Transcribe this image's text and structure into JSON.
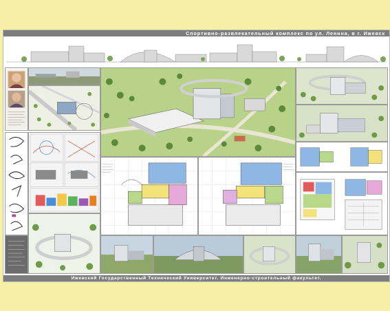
{
  "poster": {
    "title": "Спортивно-развлекательный комплекс по ул. Ленина, в г. Ижевск",
    "footer": "Ижевский Государственный Технический Университет. Инженерно-строительный факультет."
  },
  "colors": {
    "page_background": "#f6f0a6",
    "band": "#7d7d7d",
    "band_text": "#ffffff",
    "grass": "#b9d28a",
    "tree": "#5d8a3a",
    "building": "#e8e8e8",
    "blue_zone": "#8fb7e6",
    "yellow_zone": "#f3e27a"
  },
  "icons": [
    "portrait-photo",
    "building-render",
    "site-plan",
    "floor-plan",
    "sketch-figure"
  ]
}
